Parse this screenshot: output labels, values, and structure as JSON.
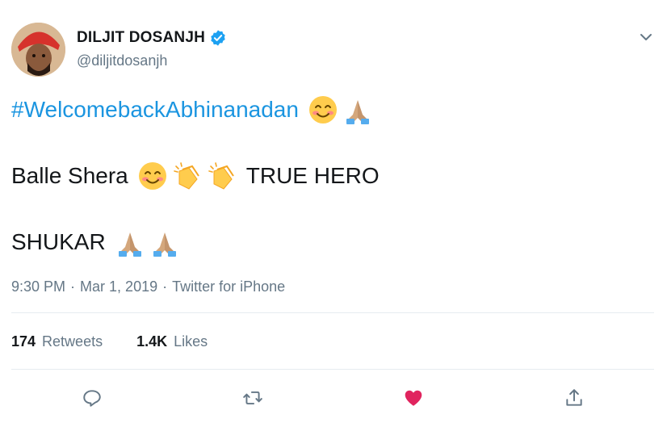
{
  "author": {
    "display_name": "DILJIT DOSANJH",
    "handle": "@diljitdosanjh",
    "verified": true,
    "avatar_icon": "profile-photo"
  },
  "tweet": {
    "line1": {
      "hashtag": "#WelcomebackAbhinanadan",
      "emojis": [
        "smiling-face-icon",
        "folded-hands-icon"
      ]
    },
    "line2": {
      "text_before": "Balle Shera",
      "emojis": [
        "smiling-face-icon",
        "clapping-hands-icon",
        "clapping-hands-icon"
      ],
      "text_after": "TRUE HERO"
    },
    "line3": {
      "text": "SHUKAR",
      "emojis": [
        "folded-hands-icon",
        "folded-hands-icon"
      ]
    }
  },
  "meta": {
    "time": "9:30 PM",
    "date": "Mar 1, 2019",
    "source": "Twitter for iPhone",
    "separator": "·"
  },
  "stats": {
    "retweets_count": "174",
    "retweets_label": "Retweets",
    "likes_count": "1.4K",
    "likes_label": "Likes"
  },
  "actions": [
    "reply-icon",
    "retweet-icon",
    "like-icon",
    "share-icon"
  ],
  "colors": {
    "link": "#1b95e0",
    "verified": "#1da1f2",
    "like_active": "#e0245e",
    "muted": "#657786",
    "icon": "#657786"
  }
}
